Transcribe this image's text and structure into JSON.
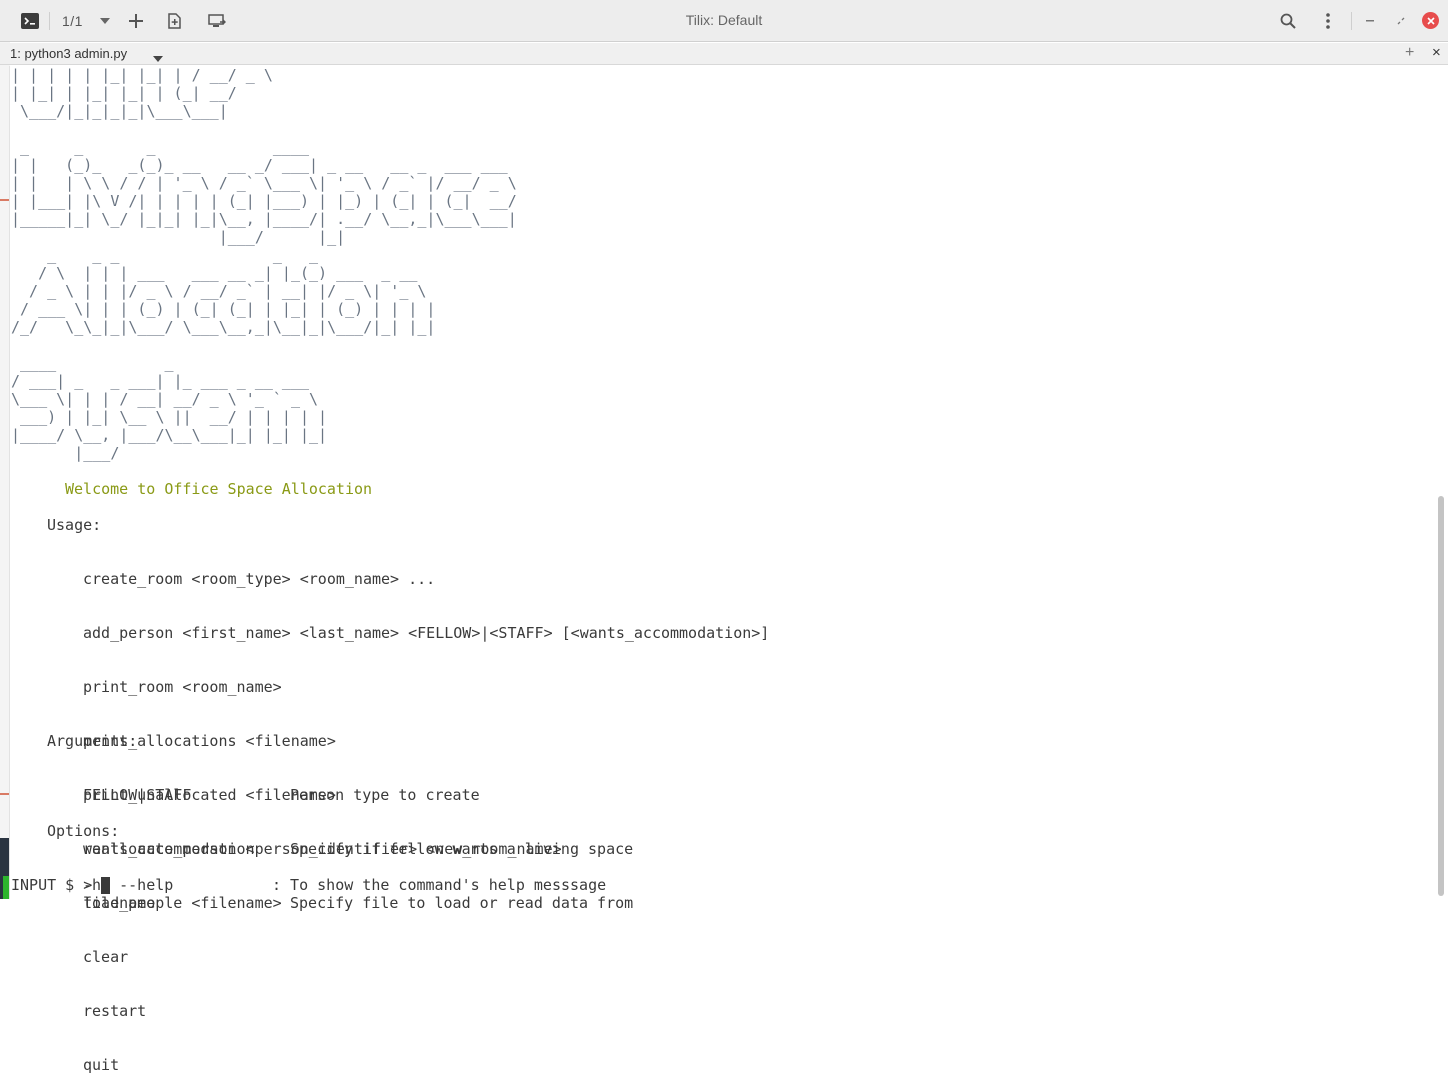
{
  "window": {
    "title": "Tilix: Default",
    "session_count": "1/1",
    "icons": {
      "app": "terminal-icon",
      "dropdown": "chevron-down-icon",
      "add": "plus-icon",
      "split": "split-terminal-icon",
      "sync": "sync-input-icon",
      "search": "search-icon",
      "menu": "kebab-menu-icon",
      "minimize": "minimize-icon",
      "maximize": "maximize-icon",
      "close": "close-icon"
    },
    "colors": {
      "close": "#e74c4c",
      "welcome": "#8a9a16",
      "prompt_marker": "#2db52d"
    }
  },
  "tab": {
    "title": "1: python3 admin.py",
    "add_glyph": "+",
    "close_glyph": "×"
  },
  "terminal": {
    "ascii_art": "| | | | | |_| |_| | / __/ _ \\\n| |_| | |_| |_| | (_| __/\n \\___/|_|_|_|_|\\___\\___|\n\n _     _       _             ____\n| |   (_)_   _(_)_ __   __ _/ ___| _ __   __ _  ___ ___\n| |   | \\ \\ / / | '_ \\ / _` \\___ \\| '_ \\ / _` |/ __/ _ \\\n| |___| |\\ V /| | | | | (_| |___) | |_) | (_| | (_|  __/\n|_____|_| \\_/ |_|_| |_|\\__, |____/| .__/ \\__,_|\\___\\___|\n                       |___/      |_|\n    _    _ _                 _   _\n   / \\  | | | ___   ___ __ _| |_(_) ___  _ __\n  / _ \\ | | |/ _ \\ / __/ _` | __| |/ _ \\| '_ \\\n / ___ \\| | | (_) | (_| (_| | |_| | (_) | | | |\n/_/   \\_\\_|_|\\___/ \\___\\__,_|\\__|_|\\___/|_| |_|\n\n ____            _\n/ ___| _   _ ___| |_ ___ _ __ ___\n\\___ \\| | | / __| __/ _ \\ '_ ` _ \\\n ___) | |_| \\__ \\ ||  __/ | | | | |\n|____/ \\__, |___/\\__\\___|_| |_| |_|\n       |___/",
    "welcome": "Welcome to Office Space Allocation",
    "usage_label": "Usage:",
    "usage": [
      "create_room <room_type> <room_name> ...",
      "add_person <first_name> <last_name> <FELLOW>|<STAFF> [<wants_accommodation>]",
      "print_room <room_name>",
      "print_allocations <filename>",
      "print_unallocated <filename>",
      "reallocate_person <person_identifier> <new_room_name>",
      "load_people <filename>",
      "clear",
      "restart",
      "quit"
    ],
    "arguments_label": "Arguments:",
    "arguments": [
      {
        "name": "FELLOW|STAFF",
        "desc": "Person type to create"
      },
      {
        "name": "wants_accommodation",
        "desc": "Specify if fellow wants a living space"
      },
      {
        "name": "filename",
        "desc": "Specify file to load or read data from"
      }
    ],
    "options_label": "Options:",
    "options": [
      {
        "name": "-h, --help",
        "desc": ": To show the command's help messsage"
      }
    ],
    "prompt": "INPUT $ >"
  }
}
